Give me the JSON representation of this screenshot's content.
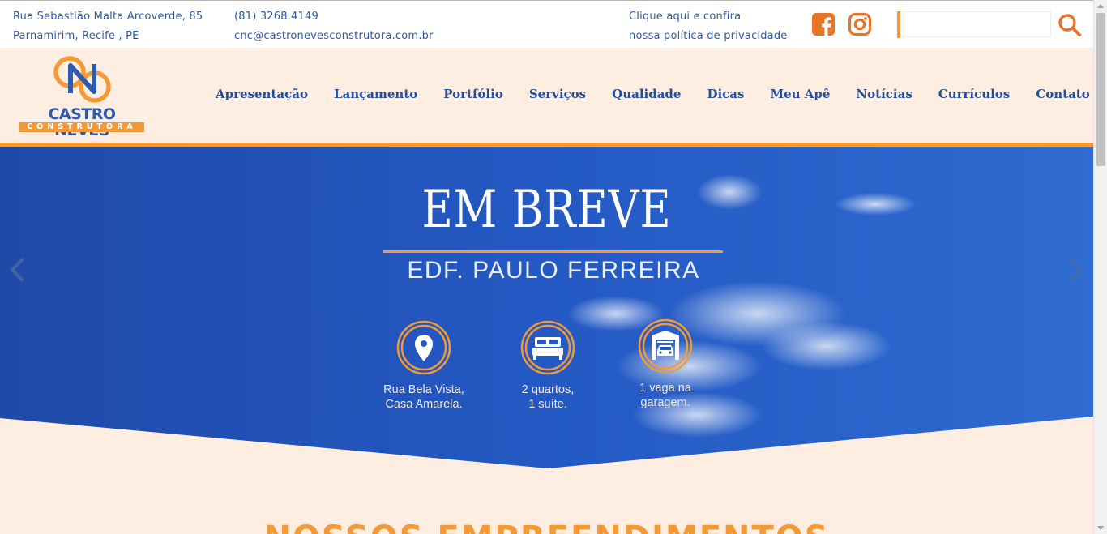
{
  "topbar": {
    "address_line1": "Rua Sebastião Malta Arcoverde, 85",
    "address_line2": "Parnamirim, Recife , PE",
    "phone": "(81) 3268.4149",
    "email": "cnc@castronevesconstrutora.com.br",
    "privacy_line1": "Clique aqui e confira",
    "privacy_line2": "nossa política de privacidade",
    "search_value": "",
    "search_placeholder": ""
  },
  "brand": {
    "name": "CASTRO NEVES",
    "tagline": "CONSTRUTORA",
    "color_orange": "#f39a37",
    "color_blue": "#2b5cb0"
  },
  "nav": {
    "items": [
      "Apresentação",
      "Lançamento",
      "Portfólio",
      "Serviços",
      "Qualidade",
      "Dicas",
      "Meu Apê",
      "Notícias",
      "Currículos",
      "Contato"
    ]
  },
  "hero": {
    "title": "EM BREVE",
    "subtitle": "EDF. PAULO FERREIRA",
    "features": [
      {
        "icon": "location-pin-icon",
        "label": "Rua Bela Vista,\nCasa Amarela."
      },
      {
        "icon": "bed-icon",
        "label": "2 quartos,\n1 suíte."
      },
      {
        "icon": "garage-car-icon",
        "label": "1 vaga na\ngaragem."
      }
    ]
  },
  "section": {
    "title": "NOSSOS EMPREENDIMENTOS"
  }
}
